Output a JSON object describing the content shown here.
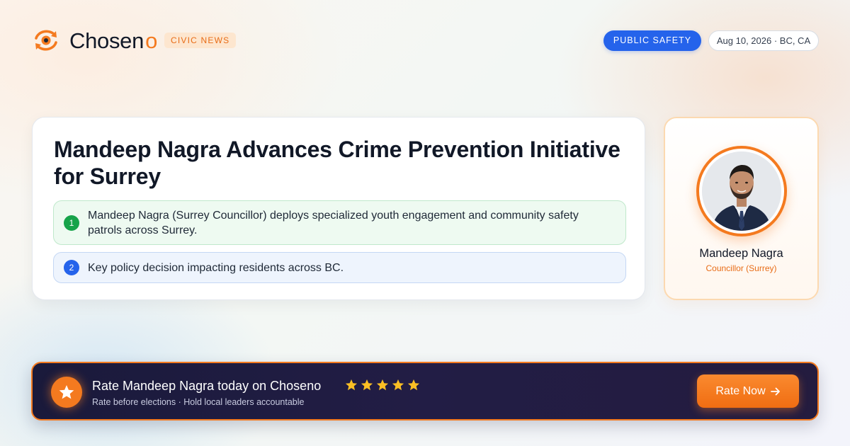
{
  "header": {
    "brand_name": "Chosen",
    "brand_accent": "o",
    "tag": "CIVIC NEWS",
    "category": "PUBLIC SAFETY",
    "date_location": "Aug 10, 2026 · BC, CA"
  },
  "article": {
    "title": "Mandeep Nagra Advances Crime Prevention Initiative for Surrey",
    "points": [
      {
        "number": "1",
        "text": "Mandeep Nagra (Surrey Councillor) deploys specialized youth engagement and community safety patrols across Surrey."
      },
      {
        "number": "2",
        "text": "Key policy decision impacting residents across BC."
      }
    ]
  },
  "profile": {
    "name": "Mandeep Nagra",
    "role": "Councillor (Surrey)"
  },
  "cta": {
    "title": "Rate Mandeep Nagra today on Choseno",
    "subtitle": "Rate before elections · Hold local leaders accountable",
    "button_label": "Rate Now",
    "star_count": 5
  },
  "colors": {
    "brand_orange": "#f47a1f",
    "category_blue": "#2563eb",
    "point1_green": "#16a34a",
    "point2_blue": "#2563eb",
    "banner_dark": "#1a1a3b",
    "star_gold": "#fbbf24"
  },
  "icons": {
    "logo": "eye-refresh-icon",
    "cta_badge": "star-icon",
    "button": "arrow-right-icon"
  }
}
